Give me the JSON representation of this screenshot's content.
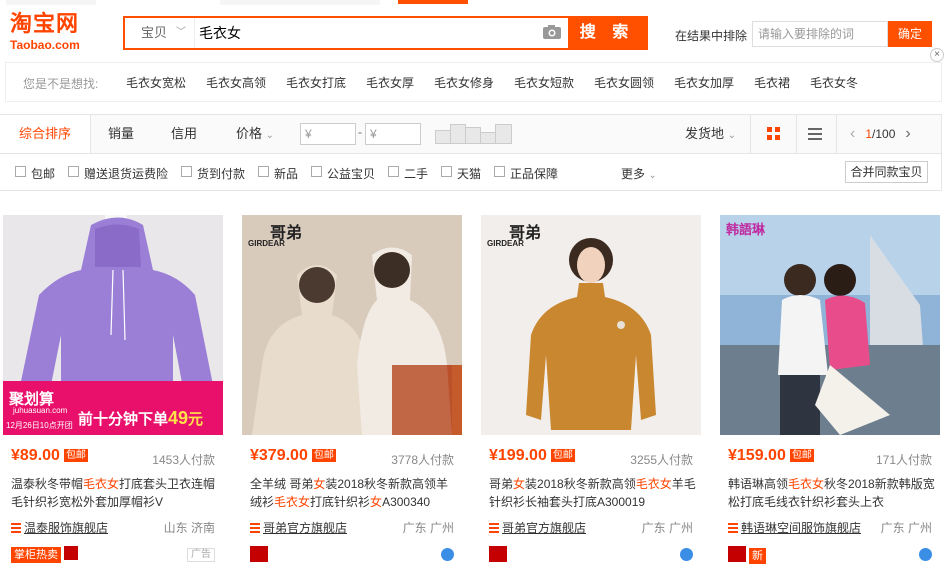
{
  "logo": {
    "cn": "淘宝网",
    "en": "Taobao.com"
  },
  "search": {
    "type_label": "宝贝",
    "query": "毛衣女",
    "button": "搜 索"
  },
  "exclude": {
    "label": "在结果中排除",
    "placeholder": "请输入要排除的词",
    "button": "确定"
  },
  "close_label": "×",
  "suggest": {
    "label": "您是不是想找:",
    "items": [
      "毛衣女宽松",
      "毛衣女高领",
      "毛衣女打底",
      "毛衣女厚",
      "毛衣女修身",
      "毛衣女短款",
      "毛衣女圆领",
      "毛衣女加厚",
      "毛衣裙",
      "毛衣女冬"
    ]
  },
  "sort": {
    "tabs": [
      "综合排序",
      "销量",
      "信用",
      "价格"
    ],
    "price_chevron": "⌄",
    "price_min": "¥",
    "price_max": "¥",
    "price_dash": "-",
    "ship": "发货地",
    "ship_chevron": "⌄",
    "page_prev": "‹",
    "page_current": "1",
    "page_total": "/100",
    "page_next": "›"
  },
  "filters": {
    "items": [
      "包邮",
      "赠送退货运费险",
      "货到付款",
      "新品",
      "公益宝贝",
      "二手",
      "天猫",
      "正品保障"
    ],
    "more": "更多",
    "more_chevron": "⌄",
    "merge": "合并同款宝贝"
  },
  "products": [
    {
      "price": "¥89.00",
      "baoyou": "包邮",
      "sales": "1453人付款",
      "title_parts": [
        "温泰秋冬带帽",
        "毛衣女",
        "打底套头卫衣连帽毛针织衫宽松外套加厚帽衫V"
      ],
      "shop": "温泰服饰旗舰店",
      "location": "山东 济南",
      "badge": "掌柜热卖",
      "ad": "广告",
      "promo": {
        "brand": "聚划算",
        "site": "juhuasuan.com",
        "date": "12月26日10点开团",
        "text": "前十分钟下单",
        "price": "49",
        "unit": "元"
      },
      "colors": {
        "bg": "#e9e7ea",
        "item": "#9b7fd6"
      }
    },
    {
      "price": "¥379.00",
      "baoyou": "包邮",
      "sales": "3778人付款",
      "title_parts": [
        "全羊绒 哥弟",
        "女",
        "装2018秋冬新款高领羊绒衫",
        "毛衣女",
        "打底针织衫",
        "女",
        "A300340"
      ],
      "shop": "哥弟官方旗舰店",
      "location": "广东 广州",
      "watermark": "GIRDEAR",
      "watermark_cn": "哥弟",
      "colors": {
        "bg": "#d9cbbc",
        "item": "#efe6dc"
      }
    },
    {
      "price": "¥199.00",
      "baoyou": "包邮",
      "sales": "3255人付款",
      "title_parts": [
        "哥弟",
        "女",
        "装2018秋冬新款高领",
        "毛衣女",
        "羊毛针织衫长袖套头打底A300019"
      ],
      "shop": "哥弟官方旗舰店",
      "location": "广东 广州",
      "watermark": "GIRDEAR",
      "watermark_cn": "哥弟",
      "colors": {
        "bg": "#f2eeeb",
        "item": "#c98730"
      }
    },
    {
      "price": "¥159.00",
      "baoyou": "包邮",
      "sales": "171人付款",
      "title_parts": [
        "韩语琳高领",
        "毛衣女",
        "秋冬2018新款韩版宽松打底毛线衣针织衫套头上衣"
      ],
      "shop": "韩语琳空间服饰旗舰店",
      "location": "广东 广州",
      "badge_new": "新",
      "watermark_cn": "韩語琳",
      "colors": {
        "bg": "#8fb4d8",
        "item": "#e84c8b"
      }
    }
  ],
  "brand_color": "#ff5000"
}
